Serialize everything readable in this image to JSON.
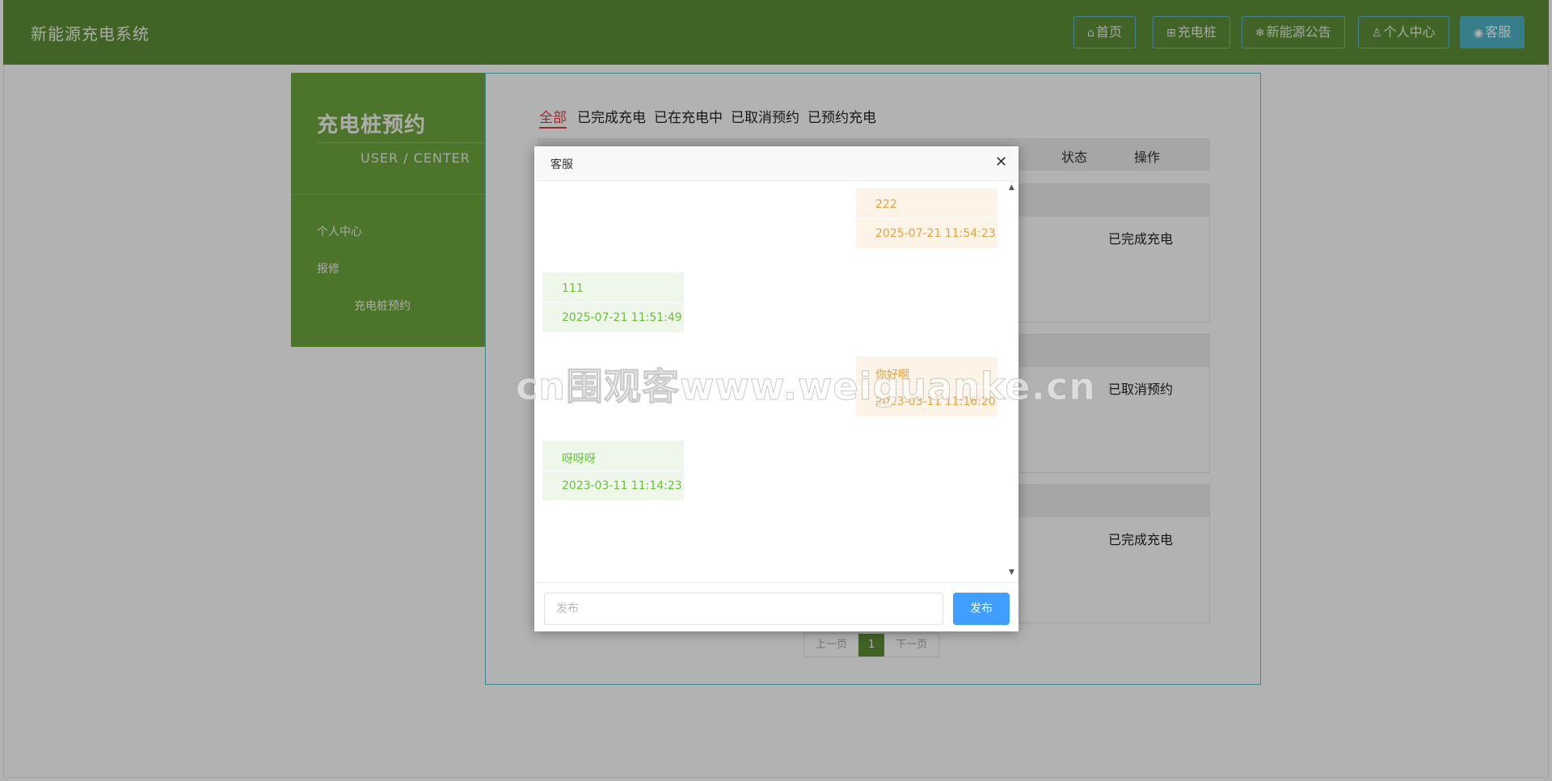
{
  "header": {
    "app_title": "新能源充电系统",
    "nav": [
      {
        "icon": "⌂",
        "label": "首页"
      },
      {
        "icon": "⊞",
        "label": "充电桩"
      },
      {
        "icon": "❄",
        "label": "新能源公告"
      },
      {
        "icon": "♙",
        "label": "个人中心"
      },
      {
        "icon": "◉",
        "label": "客服"
      }
    ],
    "active_nav": "客服",
    "colors": {
      "bar": "#5d8f35",
      "accent": "#4fb3c6"
    }
  },
  "sidebar": {
    "title": "充电桩预约",
    "subtitle": "USER / CENTER",
    "items": [
      {
        "label": "个人中心"
      },
      {
        "label": "报修"
      },
      {
        "label": "充电桩预约"
      }
    ]
  },
  "main": {
    "tabs": [
      {
        "label": "全部",
        "active": true
      },
      {
        "label": "已完成充电"
      },
      {
        "label": "已在充电中"
      },
      {
        "label": "已取消预约"
      },
      {
        "label": "已预约充电"
      }
    ],
    "columns": {
      "status": "状态",
      "action": "操作"
    },
    "rows": [
      {
        "status": "已完成充电"
      },
      {
        "status": "已取消预约"
      },
      {
        "status": "已完成充电"
      }
    ],
    "pager": {
      "prev": "上一页",
      "current": "1",
      "next": "下一页"
    }
  },
  "chat_modal": {
    "title": "客服",
    "close_icon": "close-icon",
    "messages": [
      {
        "side": "right",
        "text": "222",
        "time": "2025-07-21 11:54:23"
      },
      {
        "side": "left",
        "text": "111",
        "time": "2025-07-21 11:51:49"
      },
      {
        "side": "right",
        "text": "你好啊",
        "time": "2023-03-11 11:16:20"
      },
      {
        "side": "left",
        "text": "呀呀呀",
        "time": "2023-03-11 11:14:23"
      }
    ],
    "input": {
      "value": "",
      "placeholder": "发布"
    },
    "send_label": "发布",
    "colors": {
      "sent": "#e6a23c",
      "received": "#67c23a",
      "send_button": "#409eff"
    }
  },
  "watermark": "cn围观客www.weiguanke.cn"
}
